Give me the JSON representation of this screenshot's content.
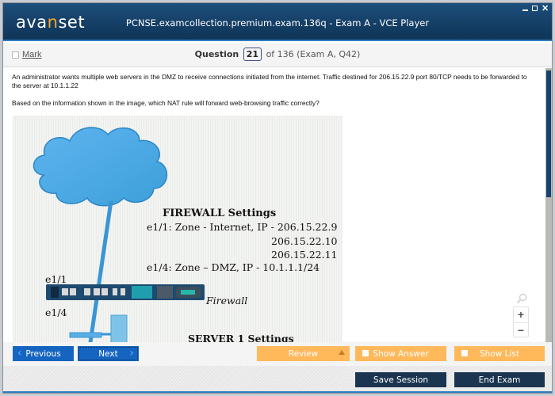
{
  "window": {
    "logo_prefix": "ava",
    "logo_accent": "n",
    "logo_suffix": "set",
    "title": "PCNSE.examcollection.premium.exam.136q - Exam A - VCE Player",
    "controls": [
      "minimize",
      "maximize",
      "close"
    ],
    "close_glyph": "✕"
  },
  "question_bar": {
    "mark_label": "Mark",
    "mark_checked": false,
    "question_label": "Question",
    "current": "21",
    "of_text": "of 136 (Exam A, Q42)"
  },
  "question": {
    "paragraphs": [
      "An administrator wants multiple web servers in the DMZ to receive connections initiated from the internet. Traffic destined for 206.15.22.9 port 80/TCP needs to be forwarded to the server at 10.1.1.22",
      "Based on the information shown in the image, which NAT rule will forward web-browsing traffic correctly?"
    ]
  },
  "exhibit": {
    "firewall_heading": "FIREWALL Settings",
    "e11_line": "e1/1:  Zone - Internet, IP - 206.15.22.9",
    "ip2": "206.15.22.10",
    "ip3": "206.15.22.11",
    "e14_line": "e1/4:  Zone – DMZ, IP - 10.1.1.1/24",
    "label_e11": "e1/1",
    "label_e14": "e1/4",
    "firewall_label": "Firewall",
    "server_heading": "SERVER 1 Settings"
  },
  "zoom_controls": {
    "zoom_in": "+",
    "zoom_out": "−"
  },
  "nav": {
    "previous": "Previous",
    "next": "Next",
    "review": "Review",
    "show_answer": "Show Answer",
    "show_list": "Show List",
    "prev_chevron": "‹",
    "next_chevron": "›"
  },
  "footer": {
    "save_session": "Save Session",
    "end_exam": "End Exam"
  },
  "colors": {
    "titlebar": "#153f66",
    "accent_blue": "#2f7dc1",
    "logo_accent": "#f7a623",
    "nav_blue": "#1565c0",
    "orange": "#ffb85a",
    "dark_button": "#1b3550"
  }
}
